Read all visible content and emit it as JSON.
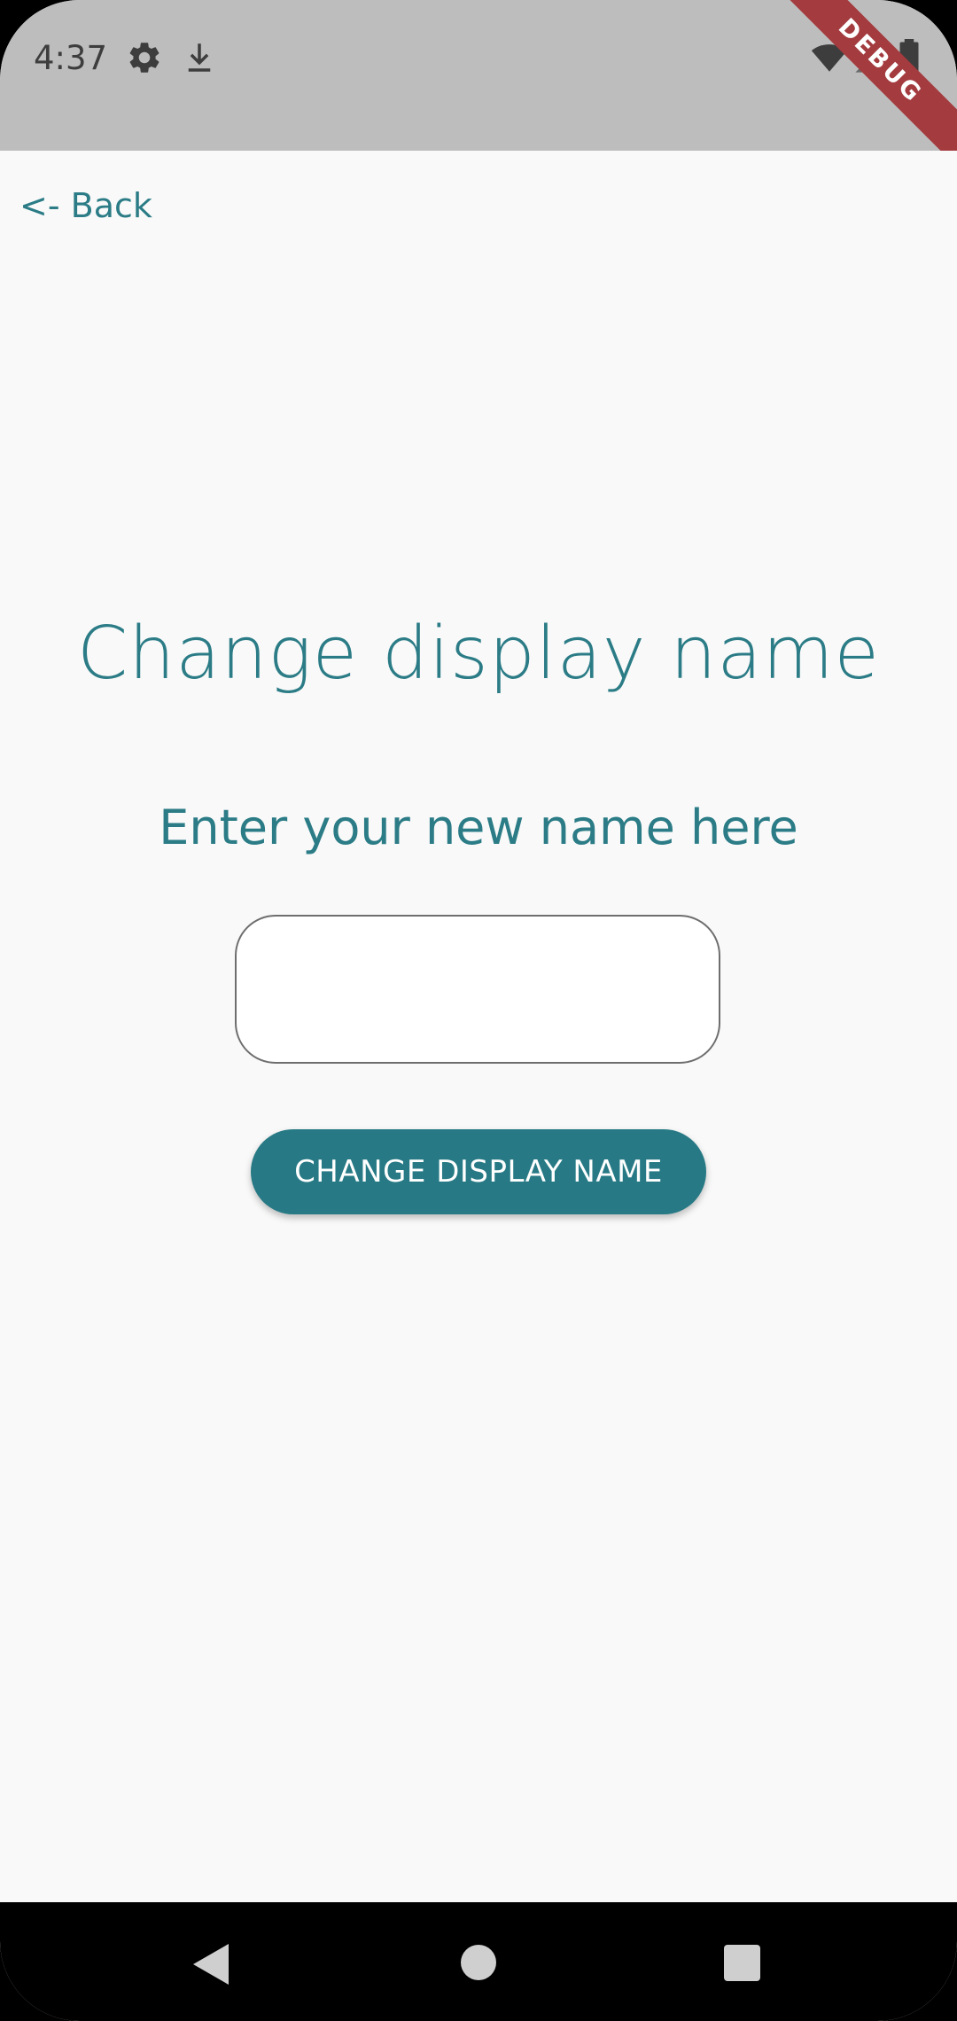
{
  "status_bar": {
    "time": "4:37",
    "icons": [
      "gear-icon",
      "download-icon",
      "wifi-icon",
      "signal-icon",
      "battery-icon"
    ],
    "debug_banner": "DEBUG"
  },
  "nav": {
    "back_label": "<- Back"
  },
  "main": {
    "title": "Change display name",
    "subtitle": "Enter your new name here",
    "input_value": "",
    "button_label": "CHANGE DISPLAY NAME"
  },
  "colors": {
    "accent": "#277a85",
    "text_accent": "#2b7c86",
    "status_bar_bg": "#bdbdbd",
    "background": "#f9f9f9",
    "debug_ribbon": "#a33b3f"
  },
  "system_nav": {
    "icons": [
      "back-triangle-icon",
      "home-circle-icon",
      "recents-square-icon"
    ]
  }
}
